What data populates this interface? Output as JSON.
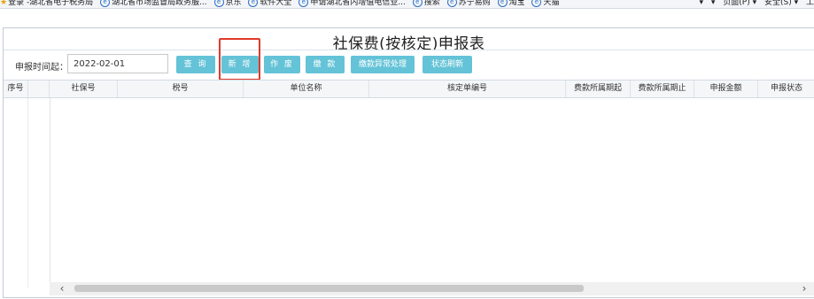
{
  "favorites_bar": {
    "items": [
      {
        "label": "登录 -湖北省电子税务局",
        "icon": "star-icon"
      },
      {
        "label": "湖北省市场监督局政务服...",
        "icon": "ie-icon"
      },
      {
        "label": "京东",
        "icon": "ie-icon"
      },
      {
        "label": "软件大全",
        "icon": "ie-icon"
      },
      {
        "label": "申请湖北省内增值电信业...",
        "icon": "ie-icon"
      },
      {
        "label": "搜索",
        "icon": "ie-icon"
      },
      {
        "label": "苏宁易购",
        "icon": "ie-icon"
      },
      {
        "label": "淘宝",
        "icon": "ie-icon"
      },
      {
        "label": "天猫",
        "icon": "ie-icon"
      }
    ],
    "tools": [
      "▾",
      "▾",
      "页面(P) ▾",
      "安全(S) ▾",
      "工"
    ]
  },
  "page": {
    "title": "社保费(按核定)申报表"
  },
  "toolbar": {
    "date_label": "申报时间起：",
    "date_value": "2022-02-01",
    "buttons": {
      "query": "查 询",
      "add": "新 增",
      "void": "作 废",
      "pay": "缴 款",
      "exception": "缴款异常处理",
      "refresh": "状态刷新"
    }
  },
  "grid": {
    "columns": [
      "序号",
      "社保号",
      "税号",
      "单位名称",
      "核定单编号",
      "费款所属期起",
      "费款所属期止",
      "申报金额",
      "申报状态"
    ],
    "rows": []
  },
  "scrollbar": {
    "left_arrow": "‹",
    "right_arrow": "›"
  },
  "colors": {
    "button": "#64c3d7",
    "highlight": "#e03a2b"
  }
}
